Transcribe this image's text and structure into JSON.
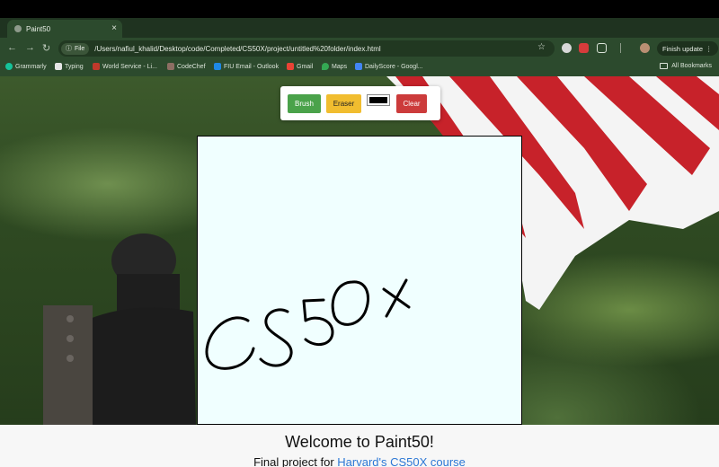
{
  "browser": {
    "tab_title": "Paint50",
    "tab_close": "×",
    "new_tab": "+",
    "tab_menu": "⌄",
    "back": "←",
    "forward": "→",
    "reload": "↻",
    "file_label": "File",
    "url": "/Users/nafiul_khalid/Desktop/code/Completed/CS50X/project/untitled%20folder/index.html",
    "star": "☆",
    "finish_update": "Finish update",
    "menu_dots": "⋮"
  },
  "bookmarks": {
    "items": [
      {
        "label": "Grammarly",
        "color": "#15c39a"
      },
      {
        "label": "Typing",
        "color": "#e5e5e5"
      },
      {
        "label": "World Service - Li...",
        "color": "#c0392b"
      },
      {
        "label": "CodeChef",
        "color": "#8d6e63"
      },
      {
        "label": "FIU Email - Outlook",
        "color": "#1e88e5"
      },
      {
        "label": "Gmail",
        "color": "#ea4335"
      },
      {
        "label": "Maps",
        "color": "#34a853"
      },
      {
        "label": "DailyScore - Googl...",
        "color": "#4285f4"
      }
    ],
    "all_bookmarks": "All Bookmarks"
  },
  "app": {
    "brush_label": "Brush",
    "eraser_label": "Eraser",
    "clear_label": "Clear",
    "stroke_color": "#000000",
    "canvas_color": "#f0ffff",
    "handwriting": "CS50X",
    "welcome": "Welcome to Paint50!",
    "subtitle_prefix": "Final project for ",
    "subtitle_link": "Harvard's CS50X course"
  }
}
